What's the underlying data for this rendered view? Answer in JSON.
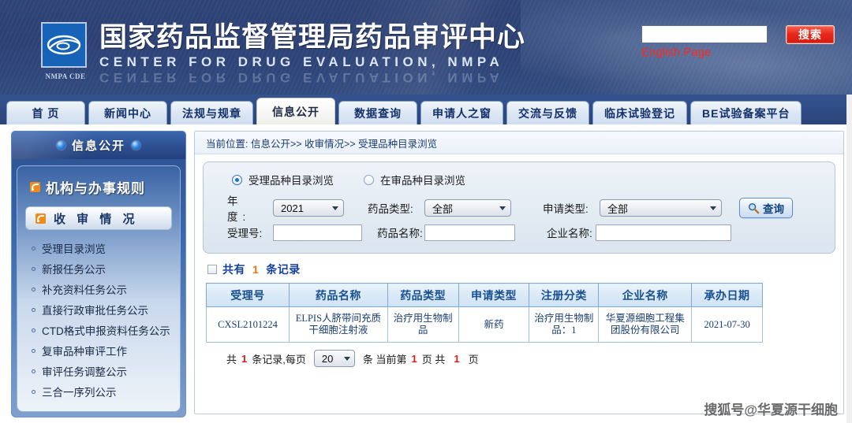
{
  "header": {
    "logo_caption": "NMPA CDE",
    "logo_icon": "cde-eye-logo-icon",
    "title_cn": "国家药品监督管理局药品审评中心",
    "title_en": "CENTER FOR DRUG EVALUATION, NMPA",
    "search_value": "",
    "search_placeholder": "",
    "search_button": "搜索",
    "english_link": "English Page",
    "accent_red": "#e7281b",
    "header_blue": "#2c4074"
  },
  "nav": {
    "tabs": [
      {
        "label": "首 页",
        "active": false
      },
      {
        "label": "新闻中心",
        "active": false
      },
      {
        "label": "法规与规章",
        "active": false
      },
      {
        "label": "信息公开",
        "active": true
      },
      {
        "label": "数据查询",
        "active": false
      },
      {
        "label": "申请人之窗",
        "active": false
      },
      {
        "label": "交流与反馈",
        "active": false
      },
      {
        "label": "临床试验登记",
        "active": false
      },
      {
        "label": "BE试验备案平台",
        "active": false
      }
    ]
  },
  "sidebar": {
    "head_title": "信息公开",
    "section_title": "机构与办事规则",
    "current_item": "收 审 情 况",
    "items": [
      {
        "label": "受理目录浏览"
      },
      {
        "label": "新报任务公示"
      },
      {
        "label": "补充资料任务公示"
      },
      {
        "label": "直接行政审批任务公示"
      },
      {
        "label": "CTD格式申报资料任务公示"
      },
      {
        "label": "复审品种审评工作"
      },
      {
        "label": "审评任务调整公示"
      },
      {
        "label": "三合一序列公示"
      }
    ]
  },
  "main": {
    "breadcrumb": "当前位置: 信息公开>> 收审情况>> 受理品种目录浏览",
    "radios": [
      {
        "label": "受理品种目录浏览",
        "selected": true
      },
      {
        "label": "在审品种目录浏览",
        "selected": false
      }
    ],
    "filters": {
      "year_label": "年  度:",
      "year_value": "2021",
      "drug_type_label": "药品类型:",
      "drug_type_value": "全部",
      "apply_type_label": "申请类型:",
      "apply_type_value": "全部",
      "accept_no_label": "受理号:",
      "accept_no_value": "",
      "drug_name_label": "药品名称:",
      "drug_name_value": "",
      "company_label": "企业名称:",
      "company_value": "",
      "query_button": "查询",
      "query_icon": "magnifier-icon"
    },
    "record_summary": {
      "prefix": "共有",
      "count": "1",
      "suffix": "条记录"
    },
    "table": {
      "columns": [
        "受理号",
        "药品名称",
        "药品类型",
        "申请类型",
        "注册分类",
        "企业名称",
        "承办日期"
      ],
      "rows": [
        {
          "accept_no": "CXSL2101224",
          "drug_name": "ELPIS人脐带间充质干细胞注射液",
          "drug_type": "治疗用生物制品",
          "apply_type": "新药",
          "register_class": "治疗用生物制品：1",
          "company": "华夏源细胞工程集团股份有限公司",
          "date": "2021-07-30"
        }
      ]
    },
    "pager": {
      "p1": "共",
      "total_records": "1",
      "p2": "条记录,每页",
      "page_size": "20",
      "p3": "条 当前第",
      "current_page": "1",
      "p4": "页 共",
      "total_pages": "1",
      "p5": "页"
    }
  },
  "watermark": "搜狐号@华夏源干细胞"
}
